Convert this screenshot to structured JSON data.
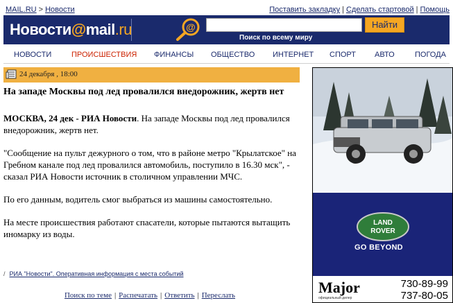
{
  "breadcrumb": {
    "home": "MAIL.RU",
    "separator": ">",
    "section": "Новости"
  },
  "toplinks": {
    "bookmark": "Поставить закладку",
    "homepage": "Сделать стартовой",
    "help": "Помощь",
    "divider": "|"
  },
  "header": {
    "logo_left": "Новости",
    "logo_at": "@",
    "logo_mail": "mail",
    "logo_domain": ".ru",
    "search_placeholder": "",
    "search_button": "Найти",
    "search_caption": "Поиск по всему миру",
    "colors": {
      "band": "#1a2a6c",
      "accent": "#f5a623"
    }
  },
  "nav": {
    "items": [
      {
        "label": "НОВОСТИ",
        "active": false
      },
      {
        "label": "ПРОИСШЕСТВИЯ",
        "active": true
      },
      {
        "label": "ФИНАНСЫ",
        "active": false
      },
      {
        "label": "ОБЩЕСТВО",
        "active": false
      },
      {
        "label": "ИНТЕРНЕТ",
        "active": false
      },
      {
        "label": "СПОРТ",
        "active": false
      },
      {
        "label": "АВТО",
        "active": false
      },
      {
        "label": "ПОГОДА",
        "active": false
      }
    ]
  },
  "article": {
    "date_icon": "newspaper-icon",
    "date": "24 декабря , 18:00",
    "headline": "На западе Москвы под лед провалился внедорожник, жертв нет",
    "lead_bold": "МОСКВА, 24 дек - РИА Новости",
    "lead_rest": ". На западе Москвы под лед провалился внедорожник, жертв нет.",
    "para2": "\"Сообщение на пульт дежурного о том, что в районе метро \"Крылатское\" на Гребном канале под лед провалился автомобиль, поступило в 16.30 мск\", - сказал РИА Новости источник в столичном управлении МЧС.",
    "para3": "По его данным, водитель смог выбраться из машины самостоятельно.",
    "para4": "На месте происшествия работают спасатели, которые пытаются вытащить иномарку из воды.",
    "source_slash": "/",
    "source_link": "РИА \"Новости\". Оперативная информация с места событий"
  },
  "bottom_links": {
    "search_topic": "Поиск по теме",
    "print": "Распечатать",
    "reply": "Ответить",
    "forward": "Переслать",
    "divider": "|"
  },
  "ad": {
    "logo_line1": "LAND",
    "logo_line2": "ROVER",
    "slogan": "GO BEYOND",
    "brand": "Major",
    "brand_sub": "официальный дилер",
    "phone1": "730-89-99",
    "phone2": "737-80-05",
    "colors": {
      "background": "#1a2478",
      "badge": "#2f7d3a"
    }
  }
}
